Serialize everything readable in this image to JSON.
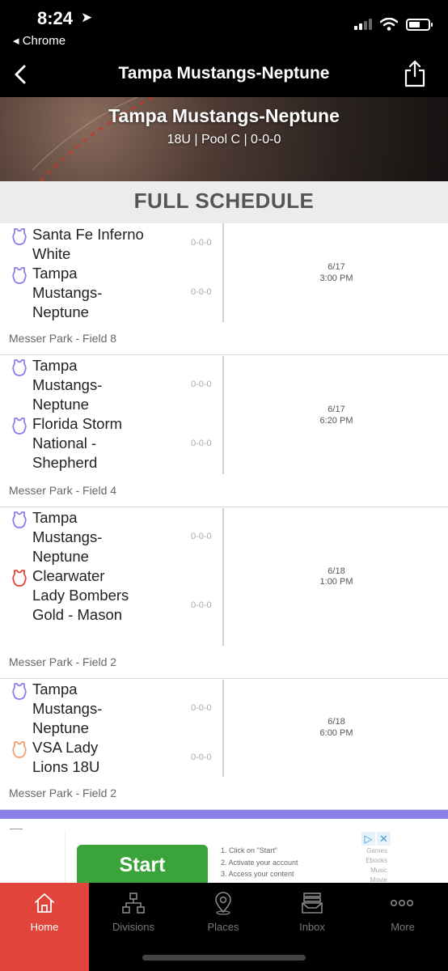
{
  "status_bar": {
    "time": "8:24",
    "back_app": "◂ Chrome"
  },
  "nav": {
    "title": "Tampa Mustangs-Neptune"
  },
  "hero": {
    "title": "Tampa Mustangs-Neptune",
    "subtitle": "18U | Pool C | 0-0-0"
  },
  "section": {
    "title": "FULL SCHEDULE"
  },
  "colors": {
    "tab_active": "#e0443a",
    "separator": "#8a7fe8",
    "icon_purple": "#8a7fe8",
    "icon_red": "#e0443a",
    "icon_orange": "#f0a070"
  },
  "games": [
    {
      "teams": [
        {
          "name": "Santa Fe Inferno White",
          "record": "0-0-0",
          "icon": "jersey-icon-purple"
        },
        {
          "name": "Tampa Mustangs-Neptune",
          "record": "0-0-0",
          "icon": "jersey-icon-purple"
        }
      ],
      "date": "6/17",
      "time": "3:00 PM",
      "venue": "Messer Park - Field 8"
    },
    {
      "teams": [
        {
          "name": "Tampa Mustangs-Neptune",
          "record": "0-0-0",
          "icon": "jersey-icon-purple"
        },
        {
          "name": "Florida Storm National - Shepherd",
          "record": "0-0-0",
          "icon": "jersey-icon-purple"
        }
      ],
      "date": "6/17",
      "time": "6:20 PM",
      "venue": "Messer Park - Field 4"
    },
    {
      "teams": [
        {
          "name": "Tampa Mustangs-Neptune",
          "record": "0-0-0",
          "icon": "jersey-icon-purple"
        },
        {
          "name": "Clearwater Lady Bombers Gold - Mason",
          "record": "0-0-0",
          "icon": "jersey-icon-red"
        }
      ],
      "date": "6/18",
      "time": "1:00 PM",
      "venue": "Messer Park - Field 2"
    },
    {
      "teams": [
        {
          "name": "Tampa Mustangs-Neptune",
          "record": "0-0-0",
          "icon": "jersey-icon-purple"
        },
        {
          "name": "VSA Lady Lions 18U",
          "record": "0-0-0",
          "icon": "jersey-icon-orange"
        }
      ],
      "date": "6/18",
      "time": "6:00 PM",
      "venue": "Messer Park - Field 2"
    }
  ],
  "ad": {
    "button": "Start",
    "steps": [
      "1. Click on \"Start\"",
      "2. Activate your account",
      "3. Access your content"
    ],
    "categories": [
      "Games",
      "Ebooks",
      "Music",
      "Movie"
    ]
  },
  "tabs": [
    {
      "label": "Home",
      "icon": "home-icon"
    },
    {
      "label": "Divisions",
      "icon": "divisions-icon"
    },
    {
      "label": "Places",
      "icon": "location-pin-icon"
    },
    {
      "label": "Inbox",
      "icon": "inbox-icon"
    },
    {
      "label": "More",
      "icon": "more-icon"
    }
  ]
}
